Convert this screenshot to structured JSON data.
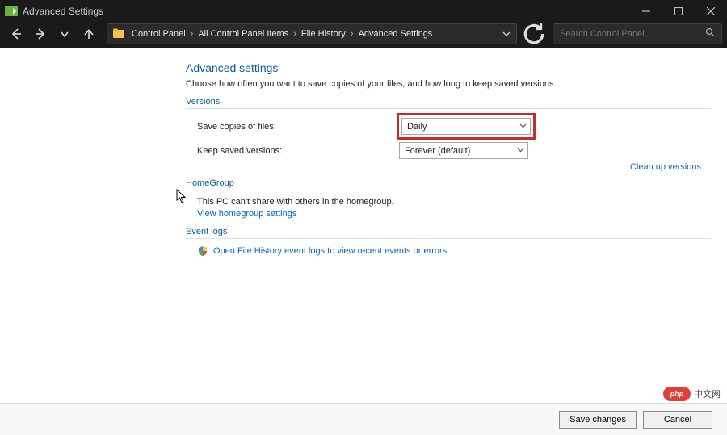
{
  "window": {
    "title": "Advanced Settings"
  },
  "breadcrumbs": [
    "Control Panel",
    "All Control Panel Items",
    "File History",
    "Advanced Settings"
  ],
  "search": {
    "placeholder": "Search Control Panel"
  },
  "page": {
    "heading": "Advanced settings",
    "description": "Choose how often you want to save copies of your files, and how long to keep saved versions."
  },
  "versions": {
    "section": "Versions",
    "save_label": "Save copies of files:",
    "save_value": "Daily",
    "keep_label": "Keep saved versions:",
    "keep_value": "Forever (default)",
    "cleanup": "Clean up versions"
  },
  "homegroup": {
    "section": "HomeGroup",
    "text": "This PC can't share with others in the homegroup.",
    "link": "View homegroup settings"
  },
  "eventlogs": {
    "section": "Event logs",
    "link": "Open File History event logs to view recent events or errors"
  },
  "footer": {
    "save": "Save changes",
    "cancel": "Cancel"
  },
  "watermark": {
    "logo": "php",
    "text": "中文网"
  }
}
